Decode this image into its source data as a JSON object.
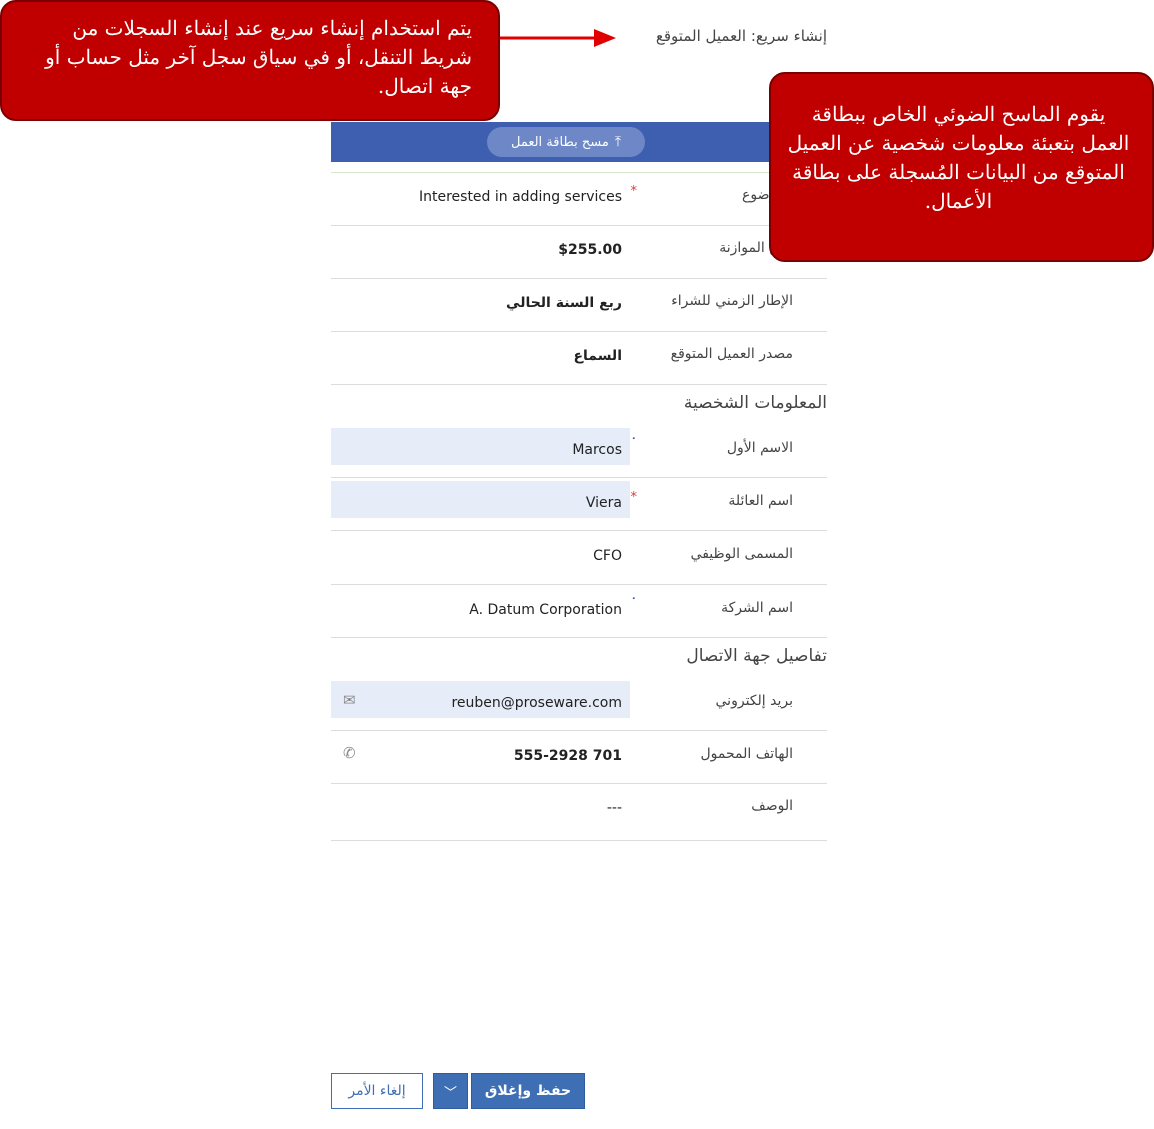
{
  "header": {
    "title": "إنشاء سريع: العميل المتوقع"
  },
  "scan_button": {
    "label": "مسح بطاقة العمل",
    "icon": "upload-arrow-icon"
  },
  "fields": [
    {
      "label": "الموضوع",
      "value": "Interested in adding services",
      "indicator": "required"
    },
    {
      "label": "مبلغ الموازنة",
      "value": "$255.00",
      "indicator": "none"
    },
    {
      "label": "الإطار الزمني للشراء",
      "value": "ربع السنة الحالي",
      "indicator": "none"
    },
    {
      "label": "مصدر العميل المتوقع",
      "value": "السماع",
      "indicator": "none"
    }
  ],
  "sections": {
    "personal": "المعلومات الشخصية",
    "contact": "تفاصيل جهة الاتصال"
  },
  "personal_fields": [
    {
      "label": "الاسم الأول",
      "value": "Marcos",
      "indicator": "recommended",
      "highlighted": true
    },
    {
      "label": "اسم العائلة",
      "value": "Viera",
      "indicator": "required",
      "highlighted": true
    },
    {
      "label": "المسمى الوظيفي",
      "value": "CFO",
      "indicator": "none",
      "highlighted": false
    },
    {
      "label": "اسم الشركة",
      "value": "A. Datum Corporation",
      "indicator": "recommended",
      "highlighted": false
    }
  ],
  "contact_fields": [
    {
      "label": "بريد إلكتروني",
      "value": "reuben@proseware.com",
      "icon": "email-icon",
      "highlighted": true
    },
    {
      "label": "الهاتف المحمول",
      "value": "555-2928 701",
      "icon": "phone-icon",
      "highlighted": false
    },
    {
      "label": "الوصف",
      "value": "---",
      "icon": "",
      "highlighted": false
    }
  ],
  "buttons": {
    "save_close": "حفظ وإغلاق",
    "cancel": "إلغاء الأمر",
    "dropdown_icon": "chevron-down-icon"
  },
  "callouts": {
    "quick_create": "يتم استخدام إنشاء سريع عند إنشاء السجلات من شريط التنقل، أو في سياق سجل آخر مثل حساب أو جهة اتصال.",
    "scanner": "يقوم الماسح الضوئي الخاص ببطاقة العمل بتعبئة معلومات شخصية عن العميل المتوقع من البيانات المُسجلة على بطاقة الأعمال."
  },
  "colors": {
    "accent": "#3e5fb0",
    "callout": "#c00000",
    "required": "#d83b3b",
    "recommended": "#2b4fcf"
  }
}
